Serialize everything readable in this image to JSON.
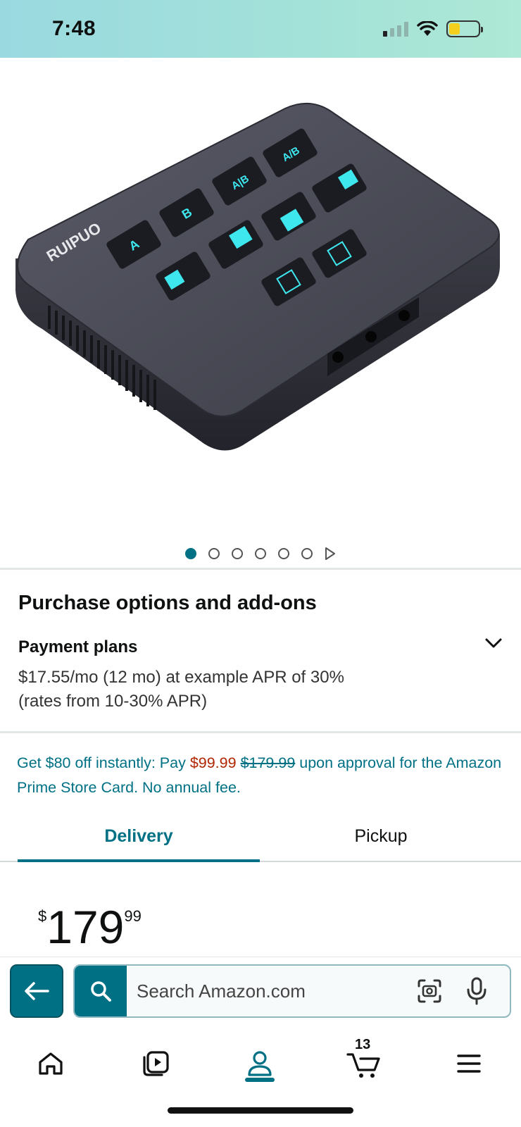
{
  "status_bar": {
    "time": "7:48",
    "icons": [
      "signal-icon",
      "wifi-icon",
      "battery-icon"
    ],
    "battery_level": 0.38
  },
  "product": {
    "brand_on_device": "RUIPUO",
    "button_labels": [
      "A",
      "B",
      "A|B",
      "A/B"
    ],
    "image_count": 6,
    "current_image": 1
  },
  "purchase": {
    "section_title": "Purchase options and add-ons",
    "plans_title": "Payment plans",
    "plans_line1": "$17.55/mo (12 mo) at example APR of 30%",
    "plans_line2": "(rates from 10-30% APR)"
  },
  "promo": {
    "prefix": "Get $80 off instantly: Pay ",
    "sale_price": "$99.99",
    "list_price": "$179.99",
    "suffix": " upon approval for the Amazon Prime Store Card. No annual fee."
  },
  "tabs": [
    {
      "label": "Delivery",
      "selected": true
    },
    {
      "label": "Pickup",
      "selected": false
    }
  ],
  "price": {
    "symbol": "$",
    "whole": "179",
    "fraction": "99"
  },
  "search": {
    "placeholder": "Search Amazon.com"
  },
  "nav": {
    "items": [
      "home-icon",
      "video-icon",
      "account-icon",
      "cart-icon",
      "menu-icon"
    ],
    "cart_count": "13",
    "active": "account-icon"
  },
  "colors": {
    "accent": "#007185",
    "sale": "#b12704",
    "status_bar": "#a3e2d8"
  }
}
